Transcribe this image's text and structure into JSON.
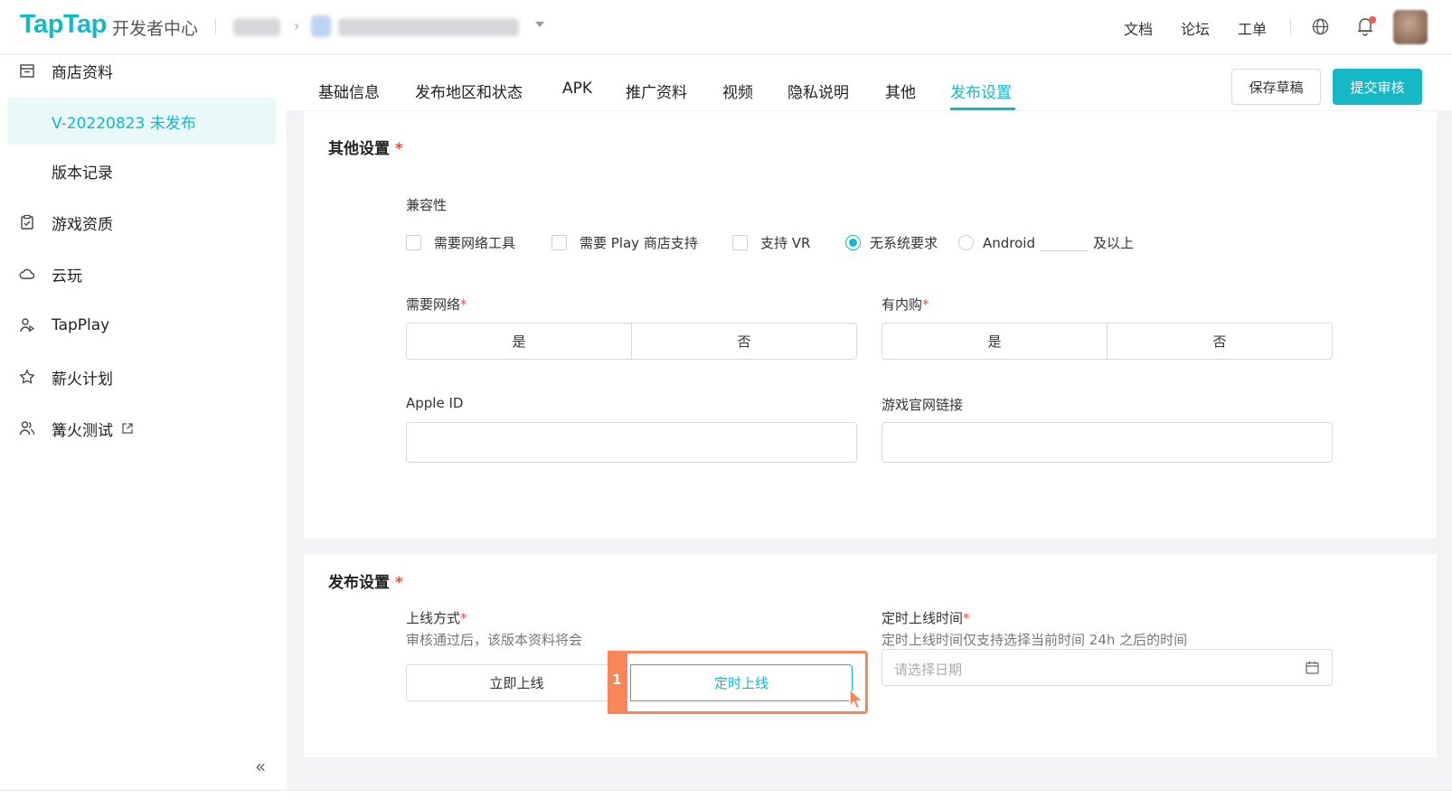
{
  "header": {
    "logo": "TapTap",
    "logo_sub": "开发者中心",
    "links": [
      "文档",
      "论坛",
      "工单"
    ],
    "icons": [
      "globe-icon",
      "bell-icon"
    ]
  },
  "sidebar": {
    "items": [
      {
        "label": "商店资料",
        "icon": "store-icon"
      },
      {
        "label": "V-20220823 未发布",
        "icon": ""
      },
      {
        "label": "版本记录",
        "icon": ""
      },
      {
        "label": "游戏资质",
        "icon": "clipboard-check-icon"
      },
      {
        "label": "云玩",
        "icon": "cloud-icon"
      },
      {
        "label": "TapPlay",
        "icon": "user-play-icon"
      },
      {
        "label": "薪火计划",
        "icon": "star-icon"
      },
      {
        "label": "篝火测试",
        "icon": "users-icon"
      }
    ],
    "collapse": "«"
  },
  "tabs": {
    "items": [
      "基础信息",
      "发布地区和状态",
      "APK",
      "推广资料",
      "视频",
      "隐私说明",
      "其他",
      "发布设置"
    ],
    "active": "发布设置",
    "save_draft": "保存草稿",
    "submit": "提交审核"
  },
  "other_settings": {
    "title": "其他设置",
    "compat_label": "兼容性",
    "compat_options": [
      "需要网络工具",
      "需要 Play 商店支持",
      "支持 VR",
      "无系统要求",
      "Android"
    ],
    "android_suffix": "及以上",
    "network_label": "需要网络",
    "network_options": [
      "是",
      "否"
    ],
    "iap_label": "有内购",
    "iap_options": [
      "是",
      "否"
    ],
    "apple_id_label": "Apple ID",
    "website_label": "游戏官网链接"
  },
  "publish_settings": {
    "title": "发布设置",
    "method_label": "上线方式",
    "method_hint": "审核通过后，该版本资料将会",
    "method_options": [
      "立即上线",
      "定时上线"
    ],
    "time_label": "定时上线时间",
    "time_hint": "定时上线时间仅支持选择当前时间 24h 之后的时间",
    "time_placeholder": "请选择日期",
    "annotation": "1"
  },
  "colors": {
    "accent": "#15b8c5",
    "highlight": "#f7875a",
    "required": "#f04b4b"
  }
}
